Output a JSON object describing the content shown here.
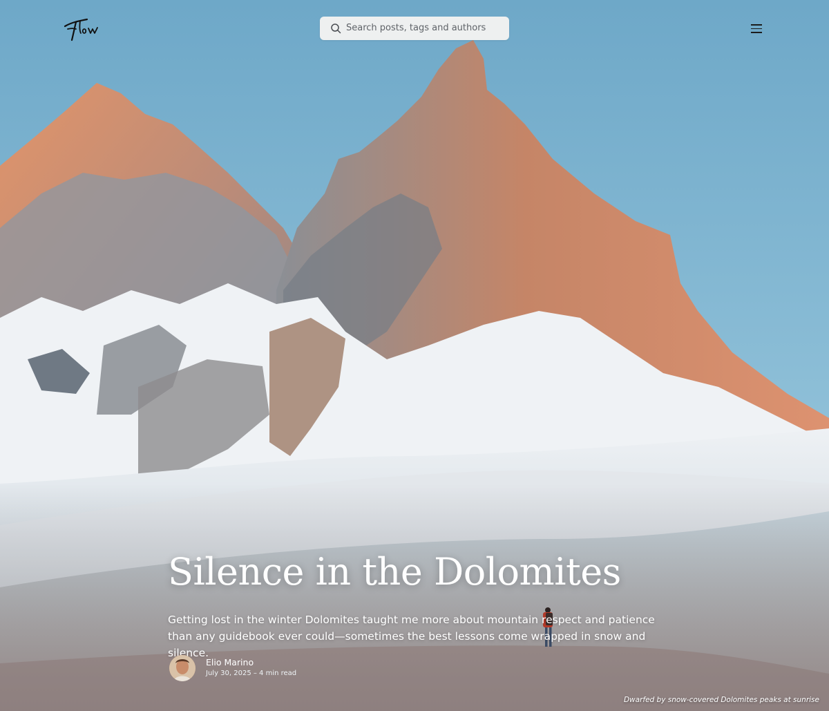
{
  "header": {
    "logo_text": "Flow",
    "search_placeholder": "Search posts, tags and authors",
    "menu_icon": "hamburger-icon"
  },
  "post": {
    "title": "Silence in the Dolomites",
    "excerpt": "Getting lost in the winter Dolomites taught me more about mountain respect and patience than any guidebook ever could—sometimes the best lessons come wrapped in snow and silence.",
    "author": {
      "name": "Elio Marino",
      "meta": "July 30, 2025 – 4 min read",
      "avatar_icon": "author-avatar"
    }
  },
  "hero": {
    "caption": "Dwarfed by snow-covered Dolomites peaks at sunrise"
  },
  "colors": {
    "sky": "#7db3cf",
    "rock_sunlit": "#d88a62",
    "rock_shadow": "#6f7a86",
    "snow": "#f1f2f4",
    "text": "#ffffff"
  }
}
